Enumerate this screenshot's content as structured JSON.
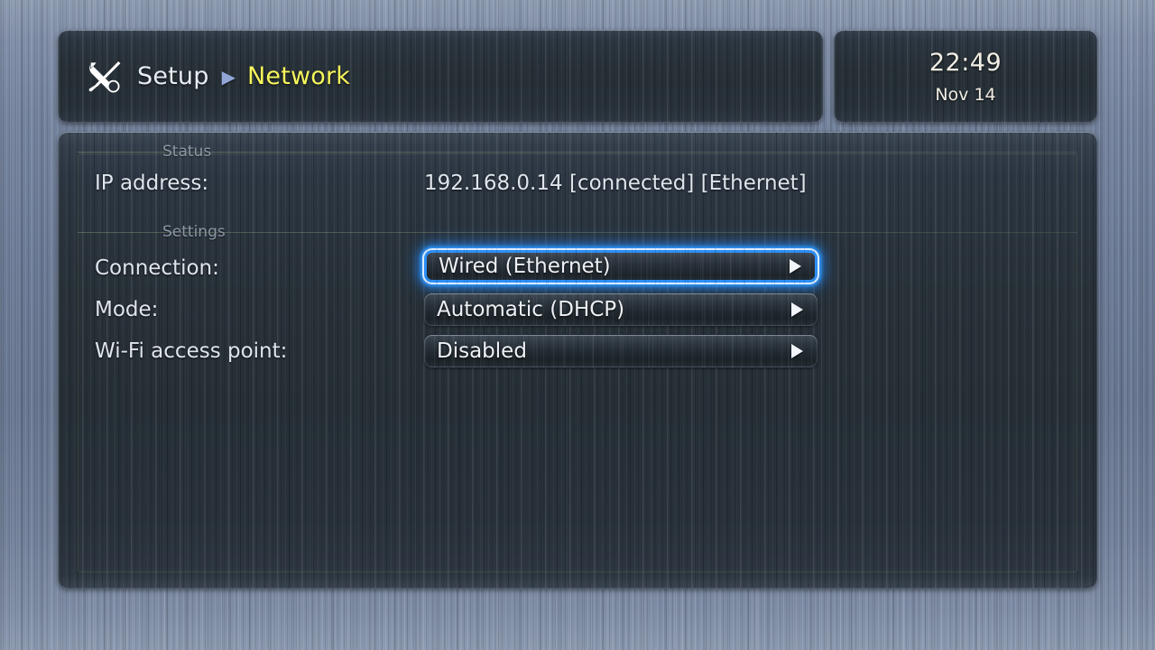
{
  "header": {
    "icon": "tools-icon",
    "breadcrumb": {
      "root": "Setup",
      "separator": "▶",
      "current": "Network"
    }
  },
  "clock": {
    "time": "22:49",
    "date": "Nov 14"
  },
  "sections": {
    "status": {
      "label": "Status",
      "rows": [
        {
          "label": "IP address:",
          "value": "192.168.0.14 [connected] [Ethernet]"
        }
      ]
    },
    "settings": {
      "label": "Settings",
      "rows": [
        {
          "label": "Connection:",
          "value": "Wired (Ethernet)",
          "selected": true,
          "arrow": "▶"
        },
        {
          "label": "Mode:",
          "value": "Automatic (DHCP)",
          "selected": false,
          "arrow": "▶"
        },
        {
          "label": "Wi-Fi access point:",
          "value": "Disabled",
          "selected": false,
          "arrow": "▶"
        }
      ]
    }
  },
  "colors": {
    "accent_highlight": "#2b8ef5",
    "breadcrumb_current": "#f6f65c",
    "breadcrumb_separator": "#93a6d8",
    "text_primary": "#dfe5ec",
    "text_section": "#8d98a6",
    "panel_dark": "#282f38",
    "background_metal": "#6f7e97"
  }
}
